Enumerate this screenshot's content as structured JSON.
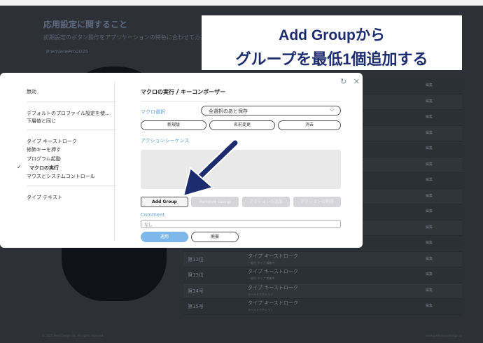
{
  "background": {
    "heading": "応用設定に関すること",
    "subtext": "初期設定のボタン操作をアプリケーションの特色に合わせてカスタマイズ",
    "app_name": "PremierePro2025",
    "rows": [
      {
        "num": "",
        "action": "",
        "sub": "",
        "edit": "編集"
      },
      {
        "num": "",
        "action": "",
        "sub": "",
        "edit": "編集"
      },
      {
        "num": "",
        "action": "",
        "sub": "",
        "edit": "編集"
      },
      {
        "num": "",
        "action": "",
        "sub": "",
        "edit": "編集"
      },
      {
        "num": "",
        "action": "",
        "sub": "",
        "edit": "編集"
      },
      {
        "num": "",
        "action": "",
        "sub": "",
        "edit": "編集"
      },
      {
        "num": "",
        "action": "",
        "sub": "",
        "edit": "編集"
      },
      {
        "num": "",
        "action": "",
        "sub": "",
        "edit": "編集"
      },
      {
        "num": "",
        "action": "",
        "sub": "",
        "edit": "編集"
      },
      {
        "num": "",
        "action": "",
        "sub": "",
        "edit": "編集"
      },
      {
        "num": "",
        "action": "",
        "sub": "",
        "edit": "編集"
      },
      {
        "num": "第12位",
        "action": "タイプ キーストローク",
        "sub": "一般的 タイプ 編集中",
        "edit": "編集"
      },
      {
        "num": "第13位",
        "action": "タイプ キーストローク",
        "sub": "一般的 タイプ 編集中",
        "edit": "編集"
      },
      {
        "num": "第14号",
        "action": "タイプ キーストローク",
        "sub": "ホールドアクション",
        "edit": "編集"
      },
      {
        "num": "第15号",
        "action": "タイプ キーストローク",
        "sub": "ホールドアクション",
        "edit": "編集"
      }
    ],
    "footer_left": "© 2025 Pixel Design Inc. All rights reserved.",
    "footer_right": "www.pixelmousedesign.jp"
  },
  "caption": {
    "line1": "Add Groupから",
    "line2": "グループを最低1個追加する"
  },
  "dialog": {
    "icons": [
      "reset-icon",
      "close-icon"
    ],
    "reset_glyph": "↻",
    "close_glyph": "✕",
    "menu": {
      "disabled": "無効",
      "default_profile": "デフォルトのプロファイル設定を使...",
      "lower_same": "下層値と同じ",
      "keystroke": "タイプ キーストローク",
      "modifier": "修飾キーを押す",
      "program": "プログラム起動",
      "macro": "マクロの実行",
      "mouse_system": "マウスとシステムコントロール",
      "type_text": "タイプ テキスト",
      "check_glyph": "✓"
    },
    "panel": {
      "title_a": "マクロの実行",
      "title_slash": "/",
      "title_b": "キーコンボーザー",
      "macro_select_label": "マクロ選択",
      "macro_select_value": "全選択のあと保存",
      "chevron_glyph": "⌵",
      "btn_new": "新規版",
      "btn_rename": "名前変更",
      "btn_delete": "消去",
      "sequence_label": "アクションシーケンス",
      "btn_add_group": "Add Group",
      "btn_remove_group": "Remove Group",
      "btn_add_action": "アクションの追加",
      "btn_remove_action": "アクションの削除",
      "comment_label": "Comment",
      "comment_value": "なし",
      "btn_apply": "適用",
      "btn_cancel": "廃棄"
    }
  },
  "colors": {
    "accent": "#5fa3dc",
    "apply": "#7eb7ea",
    "caption_text": "#1c2c6e",
    "arrow": "#1c2c6e"
  }
}
